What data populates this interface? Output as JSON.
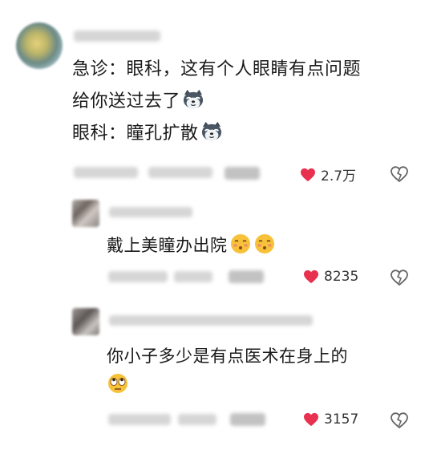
{
  "comment": {
    "lines": [
      "急诊：眼科，这有个人眼睛有点问题",
      "给你送过去了",
      "眼科：瞳孔扩散"
    ],
    "likes": "2.7万",
    "emoji": "husky-dog-emoji"
  },
  "replies": [
    {
      "text": "戴上美瞳办出院",
      "likes": "8235",
      "emoji": "embarrassed-face-emoji"
    },
    {
      "text_line1": "你小子多少是有点医术在身上的",
      "likes": "3157",
      "emoji": "eye-roll-face-emoji"
    }
  ],
  "colors": {
    "heart": "#e8304f",
    "icon_gray": "#666666"
  }
}
